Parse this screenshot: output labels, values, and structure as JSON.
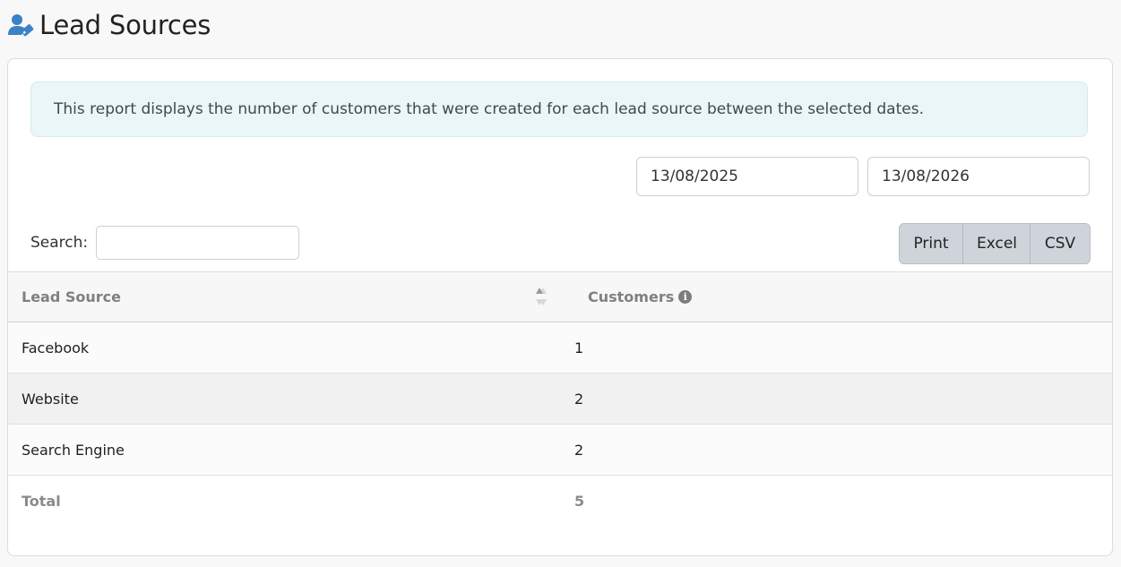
{
  "header": {
    "title": "Lead Sources",
    "icon": "user-tag-icon",
    "icon_color": "#3b82c4"
  },
  "info": {
    "text": "This report displays the number of customers that were created for each lead source between the selected dates."
  },
  "filters": {
    "date_from": "13/08/2025",
    "date_to": "13/08/2026"
  },
  "search": {
    "label": "Search:",
    "value": ""
  },
  "export_buttons": {
    "print": "Print",
    "excel": "Excel",
    "csv": "CSV"
  },
  "table": {
    "columns": [
      "Lead Source",
      "Customers"
    ],
    "rows": [
      {
        "source": "Facebook",
        "customers": "1"
      },
      {
        "source": "Website",
        "customers": "2"
      },
      {
        "source": "Search Engine",
        "customers": "2"
      }
    ],
    "total": {
      "label": "Total",
      "value": "5"
    }
  }
}
